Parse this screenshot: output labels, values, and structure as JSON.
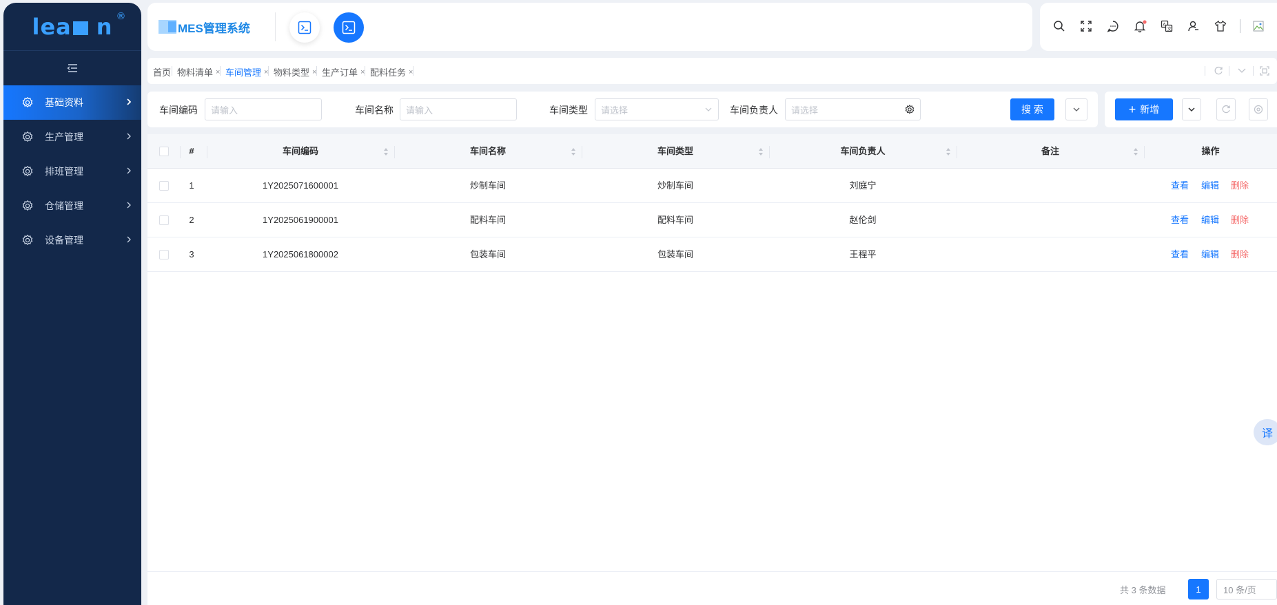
{
  "app": {
    "logo_text": "lea",
    "logo_tail": "n",
    "logo_reg": "®",
    "title": "MES管理系统"
  },
  "sidebar": {
    "items": [
      {
        "label": "基础资料",
        "active": true
      },
      {
        "label": "生产管理",
        "active": false
      },
      {
        "label": "排班管理",
        "active": false
      },
      {
        "label": "仓储管理",
        "active": false
      },
      {
        "label": "设备管理",
        "active": false
      }
    ]
  },
  "tabs": [
    {
      "label": "首页",
      "closable": false,
      "active": false
    },
    {
      "label": "物料清单",
      "closable": true,
      "active": false
    },
    {
      "label": "车间管理",
      "closable": true,
      "active": true
    },
    {
      "label": "物料类型",
      "closable": true,
      "active": false
    },
    {
      "label": "生产订单",
      "closable": true,
      "active": false
    },
    {
      "label": "配料任务",
      "closable": true,
      "active": false
    }
  ],
  "tab_close": "×",
  "search": {
    "code_label": "车间编码",
    "code_placeholder": "请输入",
    "name_label": "车间名称",
    "name_placeholder": "请输入",
    "type_label": "车间类型",
    "type_placeholder": "请选择",
    "owner_label": "车间负责人",
    "owner_placeholder": "请选择",
    "search_button": "搜 索"
  },
  "actions": {
    "add_button": "新增",
    "add_icon": "+"
  },
  "table": {
    "headers": {
      "index": "#",
      "code": "车间编码",
      "name": "车间名称",
      "type": "车间类型",
      "owner": "车间负责人",
      "remark": "备注",
      "ops": "操作"
    },
    "rows": [
      {
        "index": "1",
        "code": "1Y2025071600001",
        "name": "炒制车间",
        "type": "炒制车间",
        "owner": "刘庭宁",
        "remark": ""
      },
      {
        "index": "2",
        "code": "1Y2025061900001",
        "name": "配料车间",
        "type": "配料车间",
        "owner": "赵伦剑",
        "remark": ""
      },
      {
        "index": "3",
        "code": "1Y2025061800002",
        "name": "包装车间",
        "type": "包装车间",
        "owner": "王程平",
        "remark": ""
      }
    ],
    "op_view": "查看",
    "op_edit": "编辑",
    "op_delete": "删除"
  },
  "pagination": {
    "total_text": "共 3 条数据",
    "current_page": "1",
    "page_size": "10 条/页"
  },
  "translate_button": "译",
  "colors": {
    "primary": "#1677ff",
    "sidebar_bg": "#13284a",
    "danger": "#f56c6c",
    "notify_dot": "#f56c6c"
  },
  "icons": {
    "topbar": [
      "search-icon",
      "fullscreen-icon",
      "message-icon",
      "bell-icon",
      "translate-icon",
      "user-icon",
      "theme-shirt-icon",
      "avatar-image"
    ],
    "sidebar": "gear-icon"
  }
}
